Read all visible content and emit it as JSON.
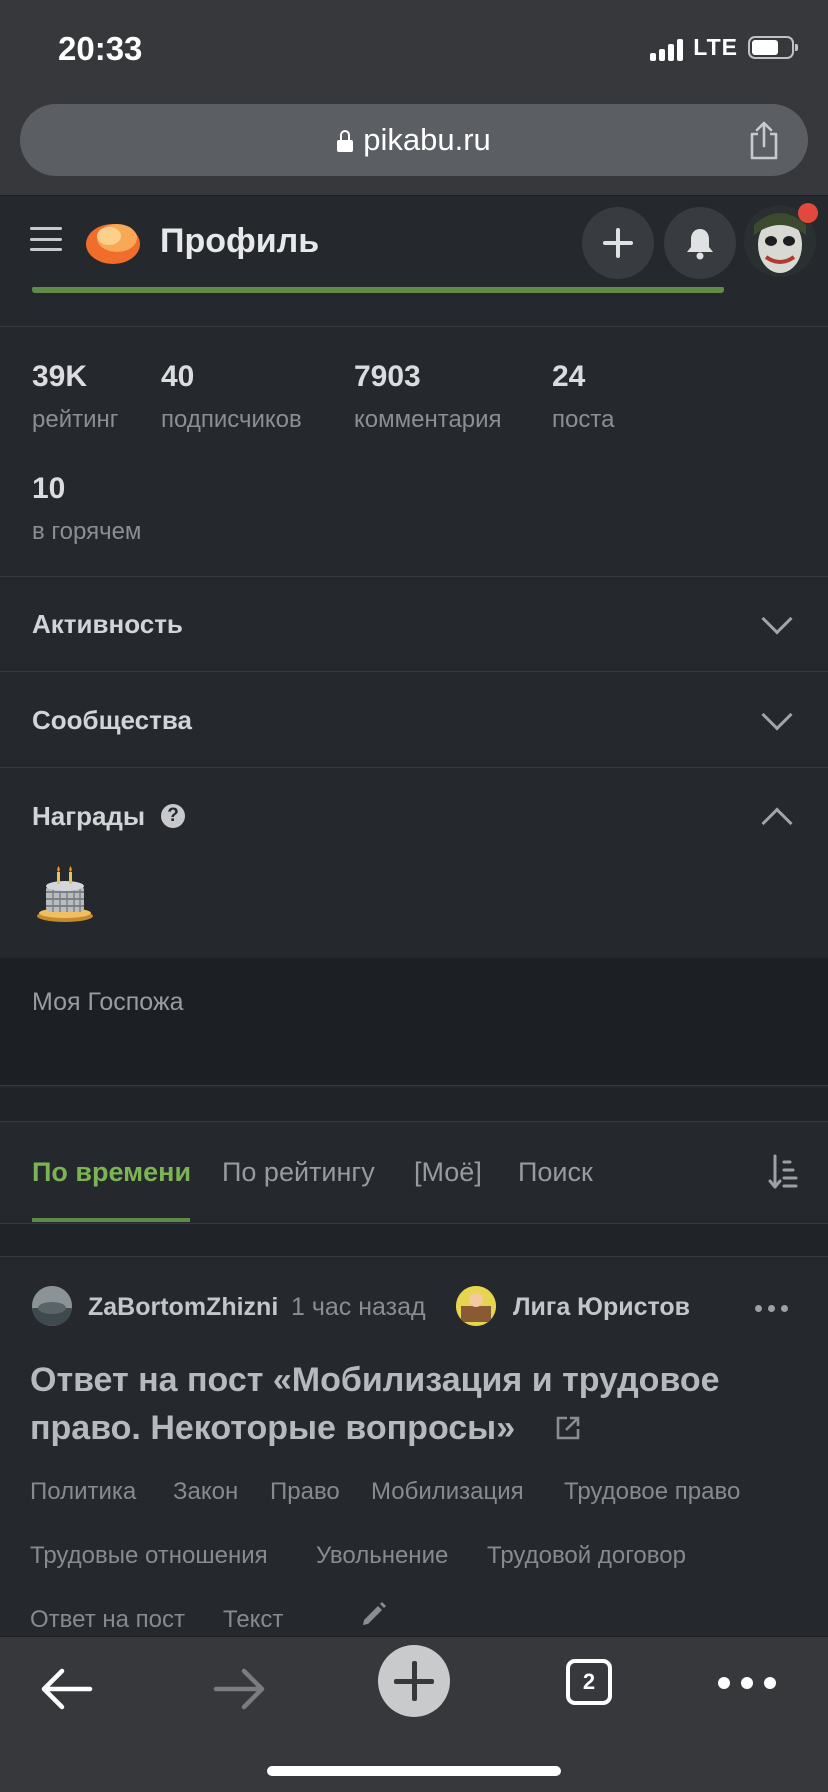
{
  "status": {
    "time": "20:33",
    "network": "LTE"
  },
  "browser": {
    "url": "pikabu.ru",
    "tabs_count": "2"
  },
  "header": {
    "title": "Профиль"
  },
  "profile": {
    "stats": [
      {
        "value": "39K",
        "label": "рейтинг"
      },
      {
        "value": "40",
        "label": "подписчиков"
      },
      {
        "value": "7903",
        "label": "комментария"
      },
      {
        "value": "24",
        "label": "поста"
      },
      {
        "value": "10",
        "label": "в горячем"
      }
    ],
    "sections": {
      "activity": "Активность",
      "communities": "Сообщества",
      "awards": "Награды"
    },
    "awards_help_glyph": "?",
    "note": "Моя Госпожа"
  },
  "feed_tabs": [
    {
      "label": "По времени",
      "active": true
    },
    {
      "label": "По рейтингу",
      "active": false
    },
    {
      "label": "[Моё]",
      "active": false
    },
    {
      "label": "Поиск",
      "active": false
    }
  ],
  "post": {
    "author": "ZaBortomZhizni",
    "time": "1 час назад",
    "community": "Лига Юристов",
    "title": "Ответ на пост «Мобилизация и трудовое право. Некоторые вопросы»",
    "tags": [
      "Политика",
      "Закон",
      "Право",
      "Мобилизация",
      "Трудовое право",
      "Трудовые отношения",
      "Увольнение",
      "Трудовой договор",
      "Ответ на пост",
      "Текст"
    ]
  },
  "colors": {
    "accent_green": "#7cb355",
    "background": "#25282d",
    "notification_dot": "#e0493b"
  }
}
